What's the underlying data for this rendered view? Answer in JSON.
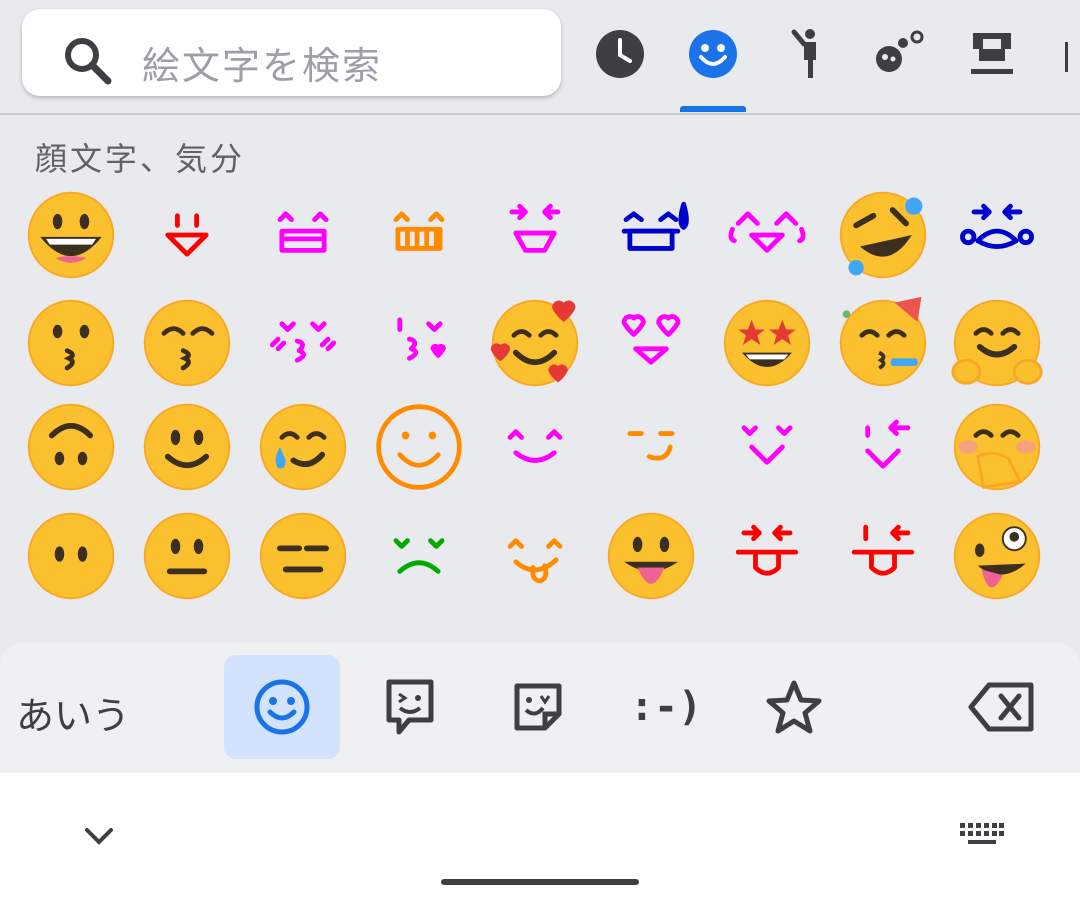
{
  "search": {
    "placeholder": "絵文字を検索"
  },
  "categories": [
    {
      "name": "recent",
      "icon": "clock-icon"
    },
    {
      "name": "smileys",
      "icon": "smiley-icon",
      "selected": true
    },
    {
      "name": "people",
      "icon": "person-icon"
    },
    {
      "name": "animals",
      "icon": "paw-icon"
    },
    {
      "name": "food",
      "icon": "cup-icon"
    }
  ],
  "section_title": "顔文字、気分",
  "grid_rows": [
    [
      {
        "kind": "emoji",
        "icon": "grinning-face"
      },
      {
        "kind": "kaomoji",
        "icon": "tongue-smile",
        "color": "#ff0000"
      },
      {
        "kind": "kaomoji",
        "icon": "happy-box",
        "color": "#ff00ff"
      },
      {
        "kind": "kaomoji",
        "icon": "grin-teeth",
        "color": "#ff8c00"
      },
      {
        "kind": "kaomoji",
        "icon": "squint-laugh",
        "color": "#ff00ff"
      },
      {
        "kind": "kaomoji",
        "icon": "sweat-smile",
        "color": "#0000cc"
      },
      {
        "kind": "kaomoji",
        "icon": "tears-of-joy",
        "color": "#ff00ff"
      },
      {
        "kind": "emoji",
        "icon": "rolling-laughing-face"
      },
      {
        "kind": "kaomoji",
        "icon": "crying-face",
        "color": "#0000cc"
      }
    ],
    [
      {
        "kind": "emoji",
        "icon": "kissing-face"
      },
      {
        "kind": "emoji",
        "icon": "kissing-smiling-eyes-face"
      },
      {
        "kind": "kaomoji",
        "icon": "kiss-blush",
        "color": "#ff00ff"
      },
      {
        "kind": "kaomoji",
        "icon": "kiss-heart",
        "color": "#ff00ff"
      },
      {
        "kind": "emoji",
        "icon": "smiling-face-with-hearts"
      },
      {
        "kind": "kaomoji",
        "icon": "heart-eyes",
        "color": "#ff00ff"
      },
      {
        "kind": "emoji",
        "icon": "star-struck-face"
      },
      {
        "kind": "emoji",
        "icon": "partying-face"
      },
      {
        "kind": "emoji",
        "icon": "hugging-face"
      }
    ],
    [
      {
        "kind": "emoji",
        "icon": "upside-down-face"
      },
      {
        "kind": "emoji",
        "icon": "slightly-smiling-face"
      },
      {
        "kind": "emoji",
        "icon": "smiling-face-with-tear"
      },
      {
        "kind": "kaomoji",
        "icon": "outline-smiley",
        "color": "#ff8c00"
      },
      {
        "kind": "kaomoji",
        "icon": "content-smile",
        "color": "#ff00ff"
      },
      {
        "kind": "kaomoji",
        "icon": "smirk",
        "color": "#ff8c00"
      },
      {
        "kind": "kaomoji",
        "icon": "v-smile",
        "color": "#ff00ff"
      },
      {
        "kind": "kaomoji",
        "icon": "wink-smile",
        "color": "#ff00ff"
      },
      {
        "kind": "emoji",
        "icon": "hand-over-mouth-face"
      }
    ],
    [
      {
        "kind": "emoji",
        "icon": "face-without-mouth"
      },
      {
        "kind": "emoji",
        "icon": "neutral-face"
      },
      {
        "kind": "emoji",
        "icon": "expressionless-face"
      },
      {
        "kind": "kaomoji",
        "icon": "frown",
        "color": "#00aa00"
      },
      {
        "kind": "kaomoji",
        "icon": "tongue-lick",
        "color": "#ff8c00"
      },
      {
        "kind": "emoji",
        "icon": "face-with-tongue"
      },
      {
        "kind": "kaomoji",
        "icon": "squint-tongue",
        "color": "#ff0000"
      },
      {
        "kind": "kaomoji",
        "icon": "wink-tongue",
        "color": "#ff0000"
      },
      {
        "kind": "emoji",
        "icon": "zany-face"
      }
    ],
    [
      {
        "kind": "emoji",
        "icon": "partial-face"
      },
      {
        "kind": "emoji",
        "icon": "partial-face"
      },
      {
        "kind": "emoji",
        "icon": "partial-face"
      },
      {
        "kind": "emoji",
        "icon": "partial-face"
      },
      {
        "kind": "blank",
        "icon": ""
      },
      {
        "kind": "blank",
        "icon": ""
      },
      {
        "kind": "kaomoji",
        "icon": "partial-kaomoji",
        "color": "#ff0000"
      },
      {
        "kind": "kaomoji",
        "icon": "partial-kaomoji",
        "color": "#ff0000"
      },
      {
        "kind": "emoji",
        "icon": "partial-face"
      }
    ]
  ],
  "keyboard_bar": {
    "abc_label": "あいう",
    "tabs": [
      {
        "name": "emoji",
        "icon": "smiley-icon",
        "active": true
      },
      {
        "name": "emoji-kitchen",
        "icon": "sticker-chat-icon"
      },
      {
        "name": "stickers",
        "icon": "sticker-icon"
      },
      {
        "name": "emoticons",
        "label": ":-)"
      },
      {
        "name": "favorites",
        "icon": "star-icon"
      }
    ],
    "delete_icon": "backspace-icon"
  },
  "nav": {
    "hide_icon": "chevron-down-icon",
    "keyboard_icon": "keyboard-icon"
  },
  "colors": {
    "accent": "#1a73e8",
    "emoji_yellow": "#fbc02d",
    "panel": "#e8eaed"
  }
}
